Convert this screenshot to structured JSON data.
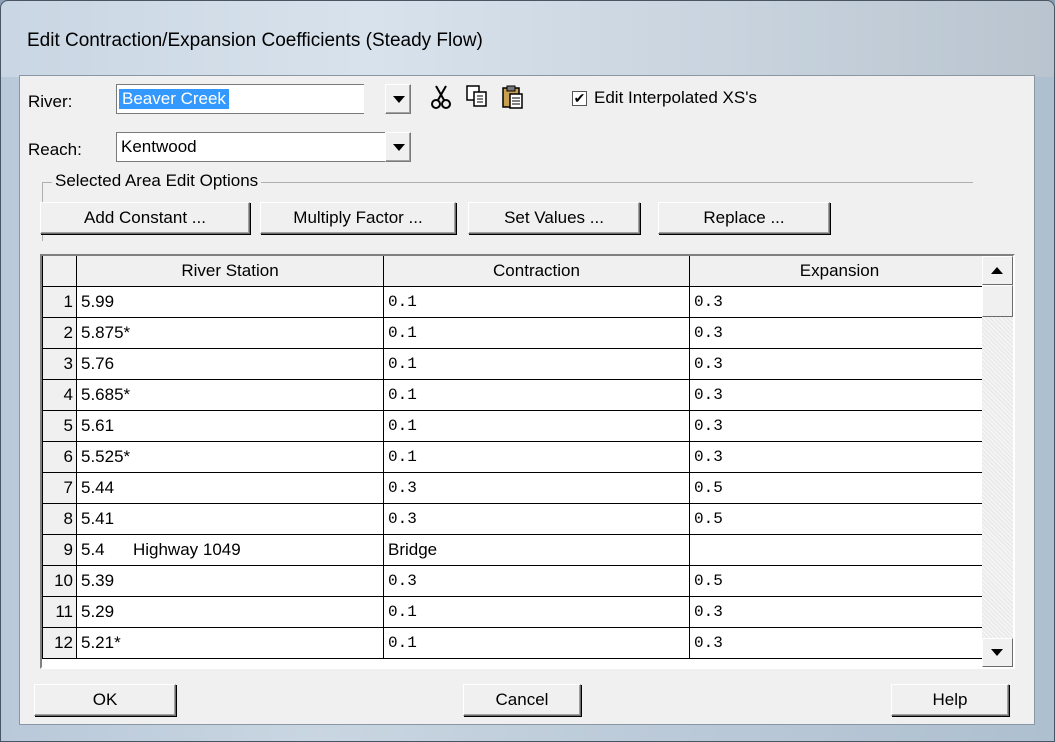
{
  "window": {
    "title": "Edit Contraction/Expansion Coefficients (Steady Flow)"
  },
  "river": {
    "label": "River:",
    "value": "Beaver Creek"
  },
  "reach": {
    "label": "Reach:",
    "value": "Kentwood"
  },
  "toolbar": {
    "cut_icon": "scissors-icon",
    "copy_icon": "copy-icon",
    "paste_icon": "paste-icon",
    "edit_interpolated_label": "Edit Interpolated XS's",
    "edit_interpolated_checked": true
  },
  "edit_options": {
    "title": "Selected Area Edit Options",
    "add_constant": "Add Constant ...",
    "multiply_factor": "Multiply Factor ...",
    "set_values": "Set Values ...",
    "replace": "Replace ..."
  },
  "table": {
    "headers": [
      "River Station",
      "Contraction",
      "Expansion"
    ],
    "rows": [
      {
        "num": "1",
        "station": "5.99",
        "contraction": "0.1",
        "expansion": "0.3"
      },
      {
        "num": "2",
        "station": "5.875*",
        "contraction": "0.1",
        "expansion": "0.3"
      },
      {
        "num": "3",
        "station": "5.76",
        "contraction": "0.1",
        "expansion": "0.3"
      },
      {
        "num": "4",
        "station": "5.685*",
        "contraction": "0.1",
        "expansion": "0.3"
      },
      {
        "num": "5",
        "station": "5.61",
        "contraction": "0.1",
        "expansion": "0.3"
      },
      {
        "num": "6",
        "station": "5.525*",
        "contraction": "0.1",
        "expansion": "0.3"
      },
      {
        "num": "7",
        "station": "5.44",
        "contraction": "0.3",
        "expansion": "0.5"
      },
      {
        "num": "8",
        "station": "5.41",
        "contraction": "0.3",
        "expansion": "0.5"
      },
      {
        "num": "9",
        "station": "5.4      Highway 1049",
        "contraction": "Bridge",
        "expansion": ""
      },
      {
        "num": "10",
        "station": "5.39",
        "contraction": "0.3",
        "expansion": "0.5"
      },
      {
        "num": "11",
        "station": "5.29",
        "contraction": "0.1",
        "expansion": "0.3"
      },
      {
        "num": "12",
        "station": "5.21*",
        "contraction": "0.1",
        "expansion": "0.3"
      }
    ]
  },
  "footer": {
    "ok": "OK",
    "cancel": "Cancel",
    "help": "Help"
  }
}
